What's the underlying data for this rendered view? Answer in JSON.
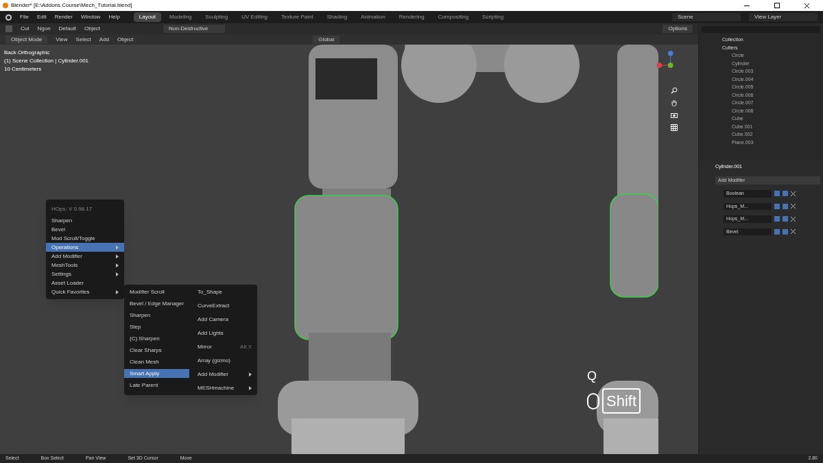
{
  "window": {
    "title": "Blender* [E:\\Addons Course\\Mech_Tutorial.blend]"
  },
  "menu_bar": [
    "File",
    "Edit",
    "Render",
    "Window",
    "Help"
  ],
  "workspaces": [
    {
      "label": "Layout",
      "selected": true
    },
    {
      "label": "Modeling",
      "selected": false
    },
    {
      "label": "Sculpting",
      "selected": false
    },
    {
      "label": "UV Editing",
      "selected": false
    },
    {
      "label": "Texture Paint",
      "selected": false
    },
    {
      "label": "Shading",
      "selected": false
    },
    {
      "label": "Animation",
      "selected": false
    },
    {
      "label": "Rendering",
      "selected": false
    },
    {
      "label": "Compositing",
      "selected": false
    },
    {
      "label": "Scripting",
      "selected": false
    }
  ],
  "scene": "Scene",
  "view_layer": "View Layer",
  "tool_settings": {
    "tool": "Cut",
    "shape": "Ngon",
    "pivot": "Default",
    "mode": "Object",
    "boolean_mode": "Non-Destructive",
    "options": "Options"
  },
  "viewport_header": {
    "mode": "Object Mode",
    "menus": [
      "View",
      "Select",
      "Add",
      "Object"
    ],
    "orientation": "Global"
  },
  "overlay_info": [
    "Back Orthographic",
    "(1) Scene Collection | Cylinder.001",
    "10 Centimeters"
  ],
  "hops_menu": {
    "title": "HOps: V 0.98.17",
    "items": [
      {
        "label": "Sharpen",
        "submenu": false,
        "selected": false
      },
      {
        "label": "Bevel",
        "submenu": false,
        "selected": false
      },
      {
        "label": "Mod Scroll/Toggle",
        "submenu": false,
        "selected": false
      },
      {
        "label": "Operations",
        "submenu": true,
        "selected": true
      },
      {
        "label": "Add Modifier",
        "submenu": true,
        "selected": false
      },
      {
        "label": "MeshTools",
        "submenu": true,
        "selected": false
      },
      {
        "label": "Settings",
        "submenu": true,
        "selected": false
      },
      {
        "label": "Asset Loader",
        "submenu": false,
        "selected": false
      },
      {
        "label": "Quick Favorites",
        "submenu": true,
        "selected": false
      }
    ]
  },
  "operations_menu": {
    "column_1": [
      {
        "label": "Modifier Scroll",
        "selected": false
      },
      {
        "label": "Bevel / Edge Manager",
        "selected": false
      },
      {
        "label": "Sharpen",
        "selected": false
      },
      {
        "label": "Step",
        "selected": false
      },
      {
        "label": "(C) Sharpen",
        "selected": false
      },
      {
        "label": "Clear Sharps",
        "selected": false
      },
      {
        "label": "Clean Mesh",
        "selected": false
      },
      {
        "label": "Smart Apply",
        "selected": true
      },
      {
        "label": "Late Parent",
        "selected": false
      }
    ],
    "column_2": [
      {
        "label": "To_Shape",
        "submenu": false
      },
      {
        "label": "CurveExtract",
        "submenu": false
      },
      {
        "label": "Add Camera",
        "submenu": false
      },
      {
        "label": "Add Lights",
        "submenu": false
      },
      {
        "label": "Mirror",
        "submenu": false,
        "shortcut": "Alt X"
      },
      {
        "label": "Array (gizmo)",
        "submenu": false
      },
      {
        "label": "Add Modifier",
        "submenu": true
      },
      {
        "label": "MESHmachine",
        "submenu": true
      }
    ]
  },
  "keystrokes": [
    "Q",
    "Shift"
  ],
  "outliner": {
    "items": [
      {
        "label": "Collection"
      },
      {
        "label": "Cutters",
        "children": [
          {
            "label": "Circle"
          },
          {
            "label": "Cylinder"
          },
          {
            "label": "Circle.003"
          },
          {
            "label": "Circle.004"
          },
          {
            "label": "Circle.005"
          },
          {
            "label": "Circle.006"
          },
          {
            "label": "Circle.007"
          },
          {
            "label": "Circle.008"
          },
          {
            "label": "Cube"
          },
          {
            "label": "Cube.001"
          },
          {
            "label": "Cube.002"
          },
          {
            "label": "Plane.003"
          }
        ]
      }
    ]
  },
  "properties": {
    "object": "Cylinder.001",
    "add_modifier": "Add Modifier",
    "modifiers": [
      "Boolean",
      "Hops_M...",
      "Hops_M...",
      "Bevel"
    ]
  },
  "status_bar": {
    "hints": [
      "Select",
      "Box Select",
      "Pan View",
      "Set 3D Cursor",
      "Move"
    ],
    "version": "2.80"
  }
}
